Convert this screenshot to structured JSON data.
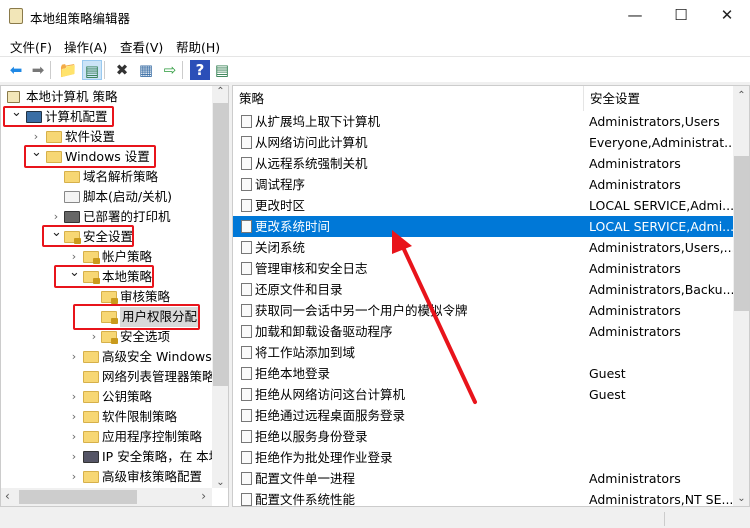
{
  "window": {
    "title": "本地组策略编辑器",
    "minimize": "—",
    "maximize": "☐",
    "close": "✕"
  },
  "menu": [
    "文件(F)",
    "操作(A)",
    "查看(V)",
    "帮助(H)"
  ],
  "toolbar": [
    {
      "icon": "back-arrow-icon",
      "glyph": "⬅",
      "color": "#1e88e5"
    },
    {
      "icon": "forward-arrow-icon",
      "glyph": "➡",
      "color": "#777"
    },
    {
      "icon": "up-folder-icon",
      "glyph": "📁",
      "color": "#d4a017"
    },
    {
      "icon": "show-hide-tree-icon",
      "glyph": "▤",
      "color": "#2a7a4a"
    },
    {
      "icon": "delete-icon",
      "glyph": "✖",
      "color": "#333"
    },
    {
      "icon": "properties-icon",
      "glyph": "▦",
      "color": "#3a6ea5"
    },
    {
      "icon": "export-list-icon",
      "glyph": "⇨",
      "color": "#2a9a3a"
    },
    {
      "icon": "help-icon",
      "glyph": "?",
      "color": "#fff"
    },
    {
      "icon": "show-action-pane-icon",
      "glyph": "▤",
      "color": "#2a7a4a"
    }
  ],
  "tree": [
    {
      "label": "本地计算机 策略",
      "level": 0,
      "chevron": "",
      "icon": "scroll"
    },
    {
      "label": "计算机配置",
      "level": 0,
      "chevron": "down",
      "icon": "computer"
    },
    {
      "label": "软件设置",
      "level": 1,
      "chevron": "right",
      "icon": "folder"
    },
    {
      "label": "Windows 设置",
      "level": 1,
      "chevron": "down",
      "icon": "folder"
    },
    {
      "label": "域名解析策略",
      "level": 2,
      "chevron": "",
      "icon": "folder"
    },
    {
      "label": "脚本(启动/关机)",
      "level": 2,
      "chevron": "",
      "icon": "script"
    },
    {
      "label": "已部署的打印机",
      "level": 2,
      "chevron": "right",
      "icon": "printer"
    },
    {
      "label": "安全设置",
      "level": 2,
      "chevron": "down",
      "icon": "security"
    },
    {
      "label": "帐户策略",
      "level": 3,
      "chevron": "right",
      "icon": "lockfolder"
    },
    {
      "label": "本地策略",
      "level": 3,
      "chevron": "down",
      "icon": "lockfolder"
    },
    {
      "label": "审核策略",
      "level": 4,
      "chevron": "",
      "icon": "lockfolder"
    },
    {
      "label": "用户权限分配",
      "level": 4,
      "chevron": "",
      "icon": "lockfolder",
      "selected": true
    },
    {
      "label": "安全选项",
      "level": 4,
      "chevron": "right",
      "icon": "lockfolder"
    },
    {
      "label": "高级安全 Windows",
      "level": 3,
      "chevron": "right",
      "icon": "folder"
    },
    {
      "label": "网络列表管理器策略",
      "level": 3,
      "chevron": "",
      "icon": "folder"
    },
    {
      "label": "公钥策略",
      "level": 3,
      "chevron": "right",
      "icon": "folder"
    },
    {
      "label": "软件限制策略",
      "level": 3,
      "chevron": "right",
      "icon": "folder"
    },
    {
      "label": "应用程序控制策略",
      "level": 3,
      "chevron": "right",
      "icon": "folder"
    },
    {
      "label": "IP 安全策略，在 本地",
      "level": 3,
      "chevron": "right",
      "icon": "ipsec"
    },
    {
      "label": "高级审核策略配置",
      "level": 3,
      "chevron": "right",
      "icon": "folder"
    }
  ],
  "list": {
    "columns": [
      "策略",
      "安全设置"
    ],
    "rows": [
      {
        "policy": "从扩展坞上取下计算机",
        "setting": "Administrators,Users"
      },
      {
        "policy": "从网络访问此计算机",
        "setting": "Everyone,Administrat..."
      },
      {
        "policy": "从远程系统强制关机",
        "setting": "Administrators"
      },
      {
        "policy": "调试程序",
        "setting": "Administrators"
      },
      {
        "policy": "更改时区",
        "setting": "LOCAL SERVICE,Admi..."
      },
      {
        "policy": "更改系统时间",
        "setting": "LOCAL SERVICE,Admi...",
        "selected": true
      },
      {
        "policy": "关闭系统",
        "setting": "Administrators,Users,..."
      },
      {
        "policy": "管理审核和安全日志",
        "setting": "Administrators"
      },
      {
        "policy": "还原文件和目录",
        "setting": "Administrators,Backu..."
      },
      {
        "policy": "获取同一会话中另一个用户的模拟令牌",
        "setting": "Administrators"
      },
      {
        "policy": "加载和卸载设备驱动程序",
        "setting": "Administrators"
      },
      {
        "policy": "将工作站添加到域",
        "setting": ""
      },
      {
        "policy": "拒绝本地登录",
        "setting": "Guest"
      },
      {
        "policy": "拒绝从网络访问这台计算机",
        "setting": "Guest"
      },
      {
        "policy": "拒绝通过远程桌面服务登录",
        "setting": ""
      },
      {
        "policy": "拒绝以服务身份登录",
        "setting": ""
      },
      {
        "policy": "拒绝作为批处理作业登录",
        "setting": ""
      },
      {
        "policy": "配置文件单一进程",
        "setting": "Administrators"
      },
      {
        "policy": "配置文件系统性能",
        "setting": "Administrators,NT SE..."
      }
    ]
  },
  "colors": {
    "selection": "#0078d7",
    "annotation": "#e8141b"
  }
}
